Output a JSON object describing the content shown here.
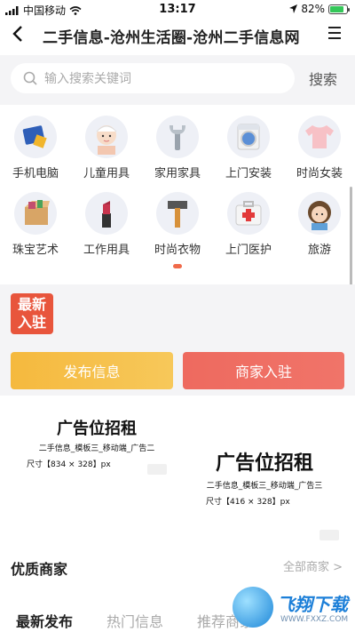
{
  "status_bar": {
    "carrier": "中国移动",
    "time": "13:17",
    "battery": "82%",
    "battery_level": 0.82
  },
  "nav": {
    "title": "二手信息-沧州生活圈-沧州二手信息网"
  },
  "search": {
    "placeholder": "输入搜索关键词",
    "button": "搜索"
  },
  "categories": [
    {
      "label": "手机电脑",
      "icon": "laptop-icon"
    },
    {
      "label": "儿童用具",
      "icon": "baby-icon"
    },
    {
      "label": "家用家具",
      "icon": "wrench-icon"
    },
    {
      "label": "上门安装",
      "icon": "washing-machine-icon"
    },
    {
      "label": "时尚女装",
      "icon": "tshirt-icon"
    },
    {
      "label": "珠宝艺术",
      "icon": "box-icon"
    },
    {
      "label": "工作用具",
      "icon": "lipstick-icon"
    },
    {
      "label": "时尚衣物",
      "icon": "hammer-icon"
    },
    {
      "label": "上门医护",
      "icon": "medical-kit-icon"
    },
    {
      "label": "旅游",
      "icon": "girl-icon"
    }
  ],
  "promo": {
    "badge_line1": "最新",
    "badge_line2": "入驻",
    "publish_btn": "发布信息",
    "merchant_btn": "商家入驻"
  },
  "ads": [
    {
      "title": "广告位招租",
      "desc": "二手信息_模板三_移动端_广告二",
      "size": "尺寸【834 × 328】px"
    },
    {
      "title": "广告位招租",
      "desc": "二手信息_模板三_移动端_广告三",
      "size": "尺寸【416 × 328】px"
    }
  ],
  "merchants": {
    "title": "优质商家",
    "more": "全部商家 >"
  },
  "tabs": [
    "最新发布",
    "热门信息",
    "推荐商家"
  ],
  "watermark": {
    "text": "飞翔下载",
    "url": "WWW.FXXZ.COM"
  }
}
